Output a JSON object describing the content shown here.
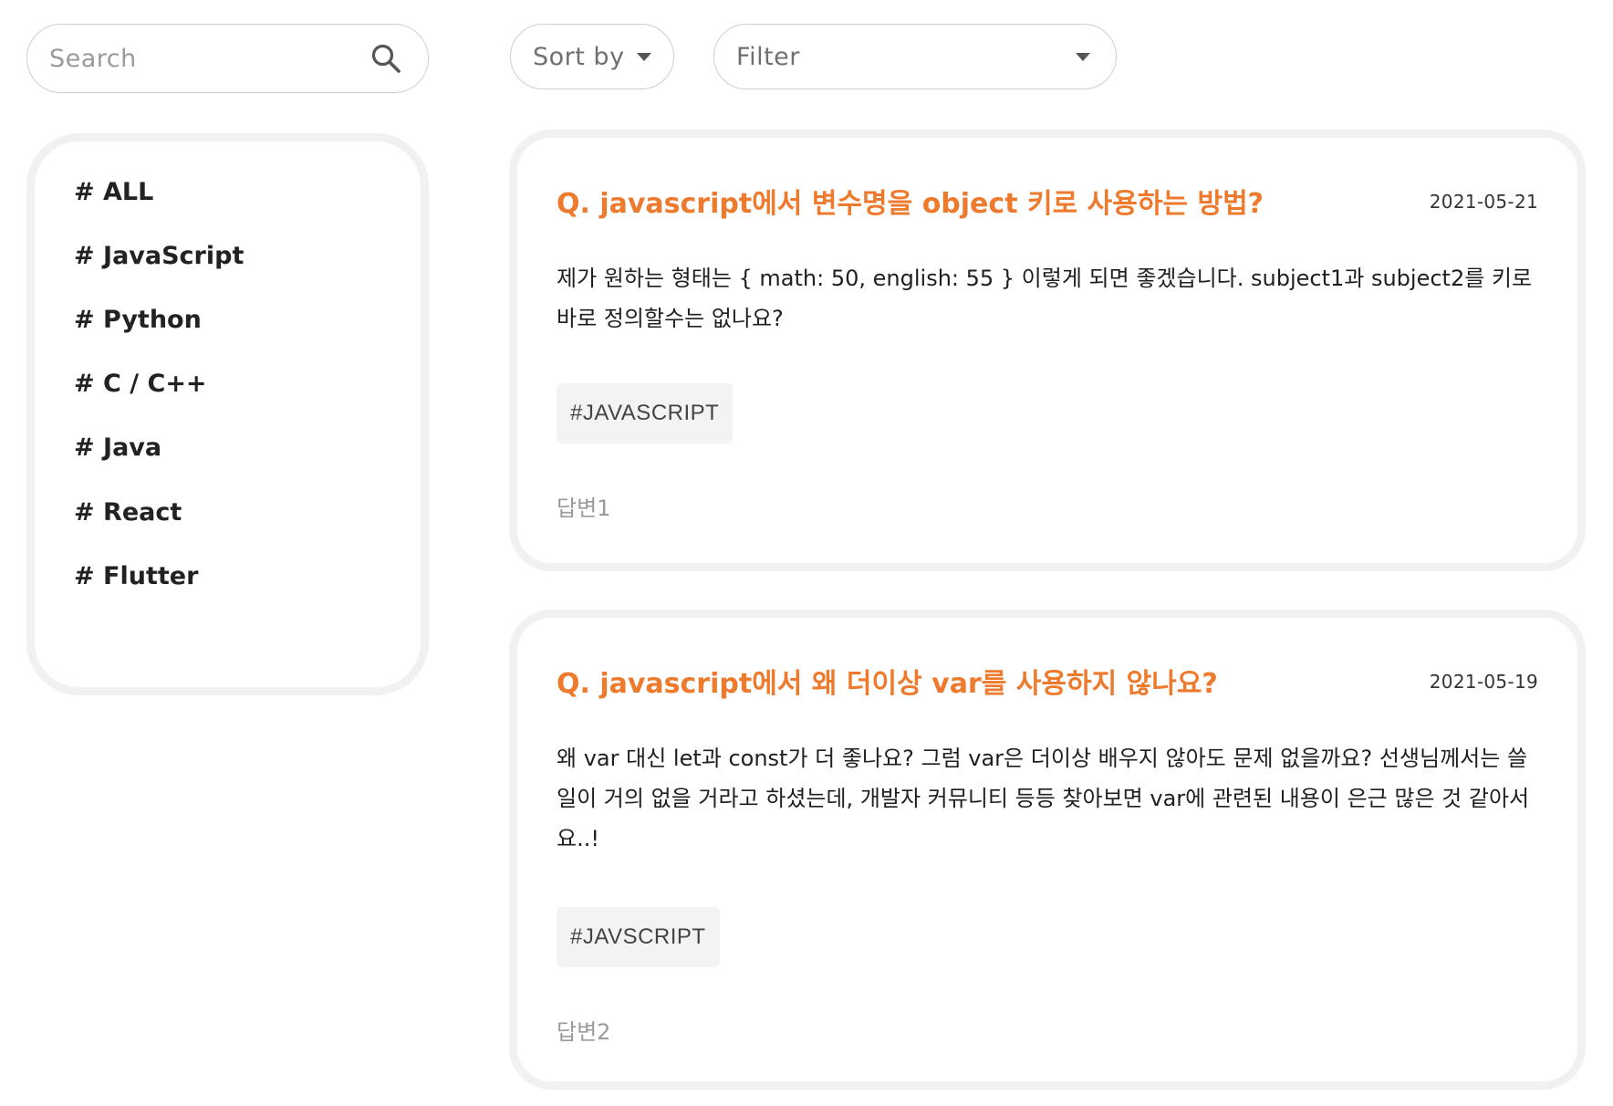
{
  "search": {
    "placeholder": "Search",
    "value": ""
  },
  "toolbar": {
    "sort_label": "Sort by",
    "filter_label": "Filter"
  },
  "sidebar": {
    "items": [
      {
        "label": "# ALL"
      },
      {
        "label": "# JavaScript"
      },
      {
        "label": "# Python"
      },
      {
        "label": "# C / C++"
      },
      {
        "label": "# Java"
      },
      {
        "label": "# React"
      },
      {
        "label": "# Flutter"
      }
    ]
  },
  "posts": [
    {
      "title": "Q. javascript에서 변수명을 object 키로 사용하는 방법?",
      "date": "2021-05-21",
      "body": "제가 원하는 형태는 { math: 50, english: 55 } 이렇게 되면 좋겠습니다. subject1과 subject2를 키로 바로 정의할수는 없나요?",
      "tag": "#JAVASCRIPT",
      "answers": "답변1"
    },
    {
      "title": "Q. javascript에서 왜 더이상 var를 사용하지 않나요?",
      "date": "2021-05-19",
      "body": "왜 var 대신 let과 const가 더 좋나요? 그럼 var은 더이상 배우지 않아도 문제 없을까요? 선생님께서는 쓸 일이 거의 없을 거라고 하셨는데, 개발자 커뮤니티 등등 찾아보면 var에 관련된 내용이 은근 많은 것 같아서요..!",
      "tag": "#JAVSCRIPT",
      "answers": "답변2"
    }
  ],
  "colors": {
    "accent": "#ee7a2e",
    "border": "#f1f1f1",
    "tag_bg": "#f3f3f3",
    "muted": "#9a9a9a"
  }
}
